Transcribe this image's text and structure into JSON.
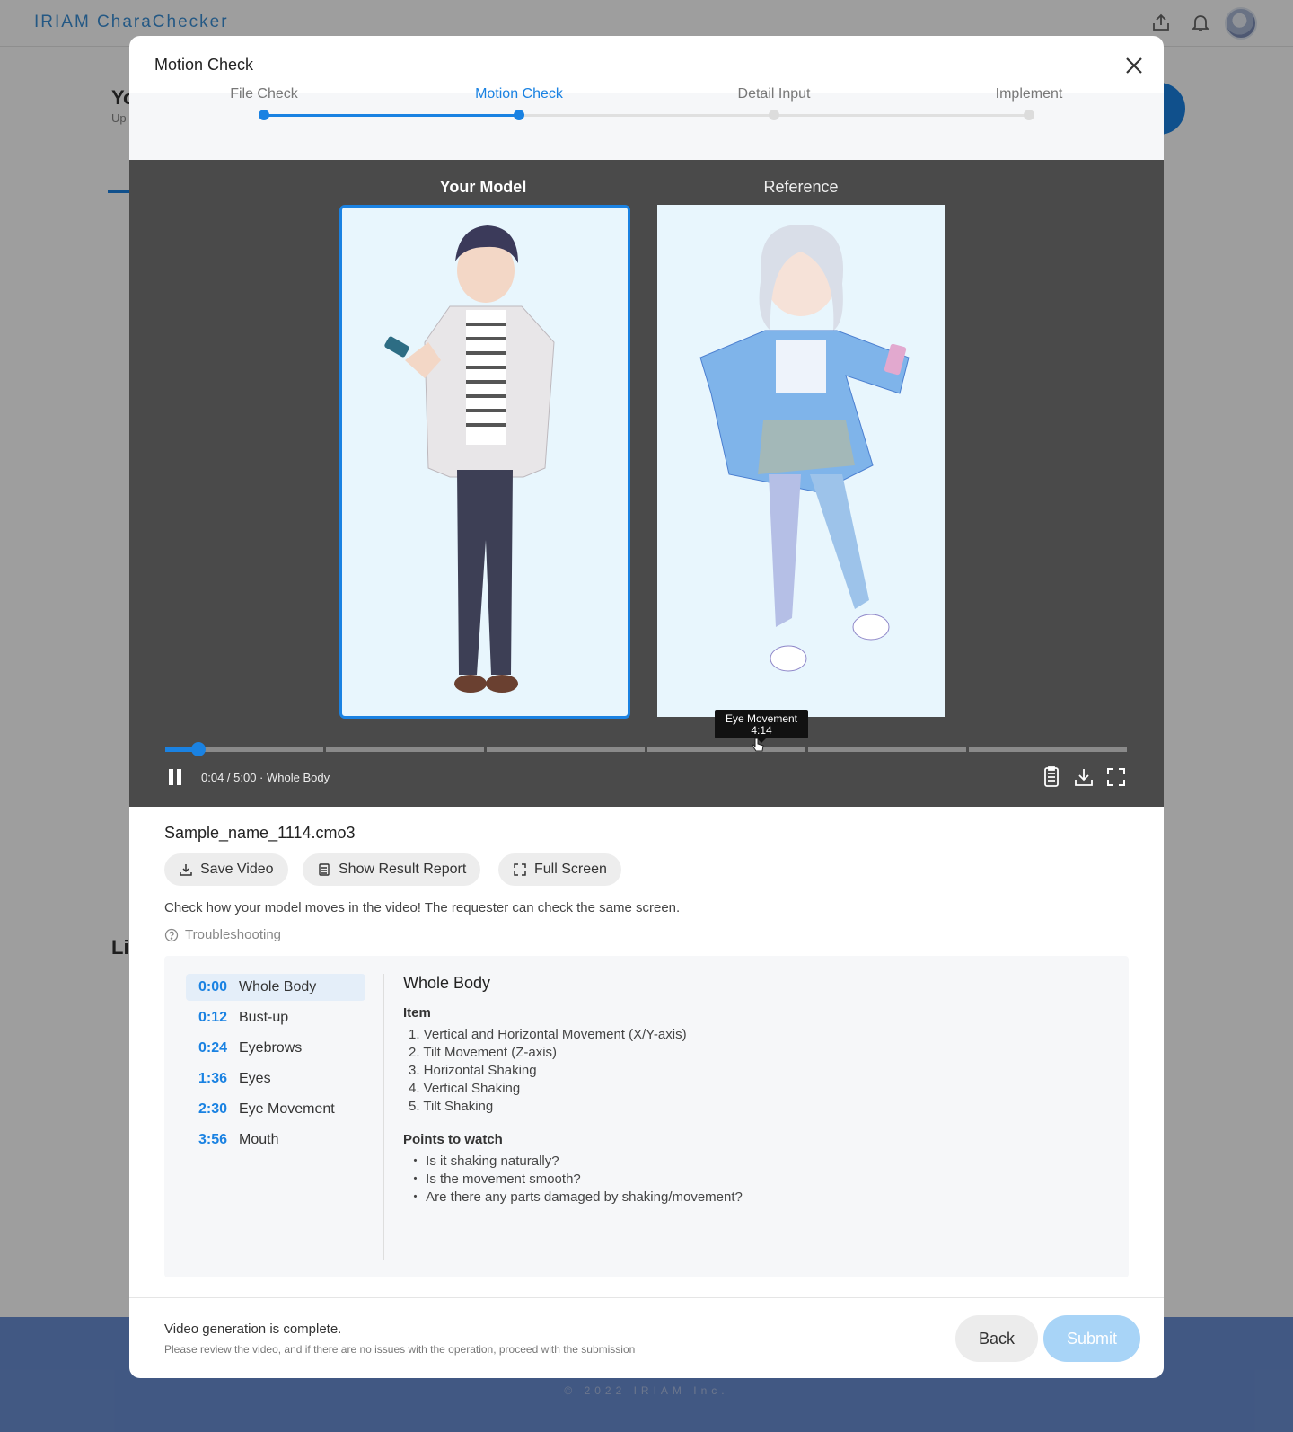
{
  "app": {
    "logo": "IRIAM CharaChecker",
    "background_title": "Yo",
    "background_subtitle": "Up",
    "background_section": "Li",
    "copyright": "© 2022 IRIAM Inc."
  },
  "modal": {
    "title": "Motion Check",
    "steps": [
      {
        "label": "File Check",
        "state": "done"
      },
      {
        "label": "Motion Check",
        "state": "active"
      },
      {
        "label": "Detail Input",
        "state": "pending"
      },
      {
        "label": "Implement",
        "state": "pending"
      }
    ]
  },
  "player": {
    "your_model_label": "Your Model",
    "reference_label": "Reference",
    "tooltip_title": "Eye Movement",
    "tooltip_time": "4:14",
    "time_readout": "0:04 / 5:00 · Whole Body",
    "progress_fraction": 0.013,
    "segment_count": 6
  },
  "file": {
    "name": "Sample_name_1114.cmo3",
    "save_video": "Save Video",
    "show_report": "Show Result Report",
    "full_screen": "Full Screen",
    "description": "Check how your model moves in the video! The requester can check the same screen.",
    "troubleshooting": "Troubleshooting"
  },
  "chapters": [
    {
      "time": "0:00",
      "name": "Whole Body",
      "active": true
    },
    {
      "time": "0:12",
      "name": "Bust-up"
    },
    {
      "time": "0:24",
      "name": "Eyebrows"
    },
    {
      "time": "1:36",
      "name": "Eyes"
    },
    {
      "time": "2:30",
      "name": "Eye Movement"
    },
    {
      "time": "3:56",
      "name": "Mouth"
    }
  ],
  "detail": {
    "title": "Whole Body",
    "items_heading": "Item",
    "items": [
      "1. Vertical and Horizontal Movement (X/Y-axis)",
      "2. Tilt Movement (Z-axis)",
      "3. Horizontal Shaking",
      "4. Vertical Shaking",
      "5. Tilt Shaking"
    ],
    "points_heading": "Points to watch",
    "points": [
      "・ Is it shaking naturally?",
      "・ Is the movement smooth?",
      "・ Are there any parts damaged by shaking/movement?"
    ]
  },
  "footer": {
    "status": "Video generation is complete.",
    "hint": "Please review the video, and if there are no issues with the operation, proceed with the submission",
    "back": "Back",
    "submit": "Submit"
  },
  "colors": {
    "accent": "#1a82e2",
    "player_bg": "#4a4a4a",
    "submit_disabled": "#a8d4f7"
  }
}
